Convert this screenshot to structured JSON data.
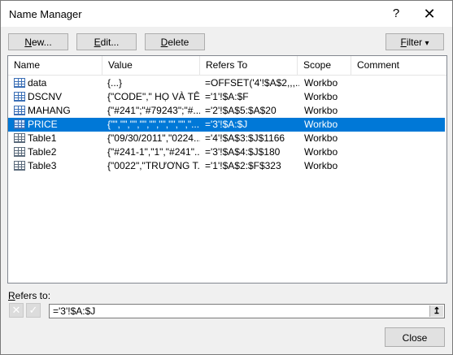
{
  "window": {
    "title": "Name Manager",
    "help_icon": "?",
    "close_icon": "✕"
  },
  "toolbar": {
    "new_label": "New...",
    "edit_label": "Edit...",
    "delete_label": "Delete",
    "filter_label": "Filter",
    "filter_arrow": "▾"
  },
  "columns": {
    "name": "Name",
    "value": "Value",
    "refers_to": "Refers To",
    "scope": "Scope",
    "comment": "Comment"
  },
  "rows": [
    {
      "icon": "named-range-icon",
      "name": "data",
      "value": "{...}",
      "refers_to": "=OFFSET('4'!$A$2,,,...",
      "scope": "Workbo",
      "comment": ""
    },
    {
      "icon": "named-range-icon",
      "name": "DSCNV",
      "value": "{\"CODE\",\" HỌ VÀ TÊ...",
      "refers_to": "='1'!$A:$F",
      "scope": "Workbo",
      "comment": ""
    },
    {
      "icon": "named-range-icon",
      "name": "MAHANG",
      "value": "{\"#241\";\"#79243\";\"#...",
      "refers_to": "='2'!$A$5:$A$20",
      "scope": "Workbo",
      "comment": ""
    },
    {
      "icon": "named-range-icon",
      "name": "PRICE",
      "value": "{\"\",\"\",\"\",\"\",\"\",\"\",\"\",\"\",\"...",
      "refers_to": "='3'!$A:$J",
      "scope": "Workbo",
      "comment": ""
    },
    {
      "icon": "table-icon",
      "name": "Table1",
      "value": "{\"09/30/2011\",\"0224...",
      "refers_to": "='4'!$A$3:$J$1166",
      "scope": "Workbo",
      "comment": ""
    },
    {
      "icon": "table-icon",
      "name": "Table2",
      "value": "{\"#241-1\",\"1\",\"#241\"...",
      "refers_to": "='3'!$A$4:$J$180",
      "scope": "Workbo",
      "comment": ""
    },
    {
      "icon": "table-icon",
      "name": "Table3",
      "value": "{\"0022\",\"TRƯƠNG T...",
      "refers_to": "='1'!$A$2:$F$323",
      "scope": "Workbo",
      "comment": ""
    }
  ],
  "selected_row": "PRICE",
  "refers": {
    "label": "Refers to:",
    "value": "='3'!$A:$J",
    "cancel_icon": "✕",
    "confirm_icon": "✓",
    "collapse_icon": "↥"
  },
  "footer": {
    "close_label": "Close"
  },
  "colors": {
    "selection": "#0078d7",
    "dialog_bg": "#f0f0f0"
  }
}
